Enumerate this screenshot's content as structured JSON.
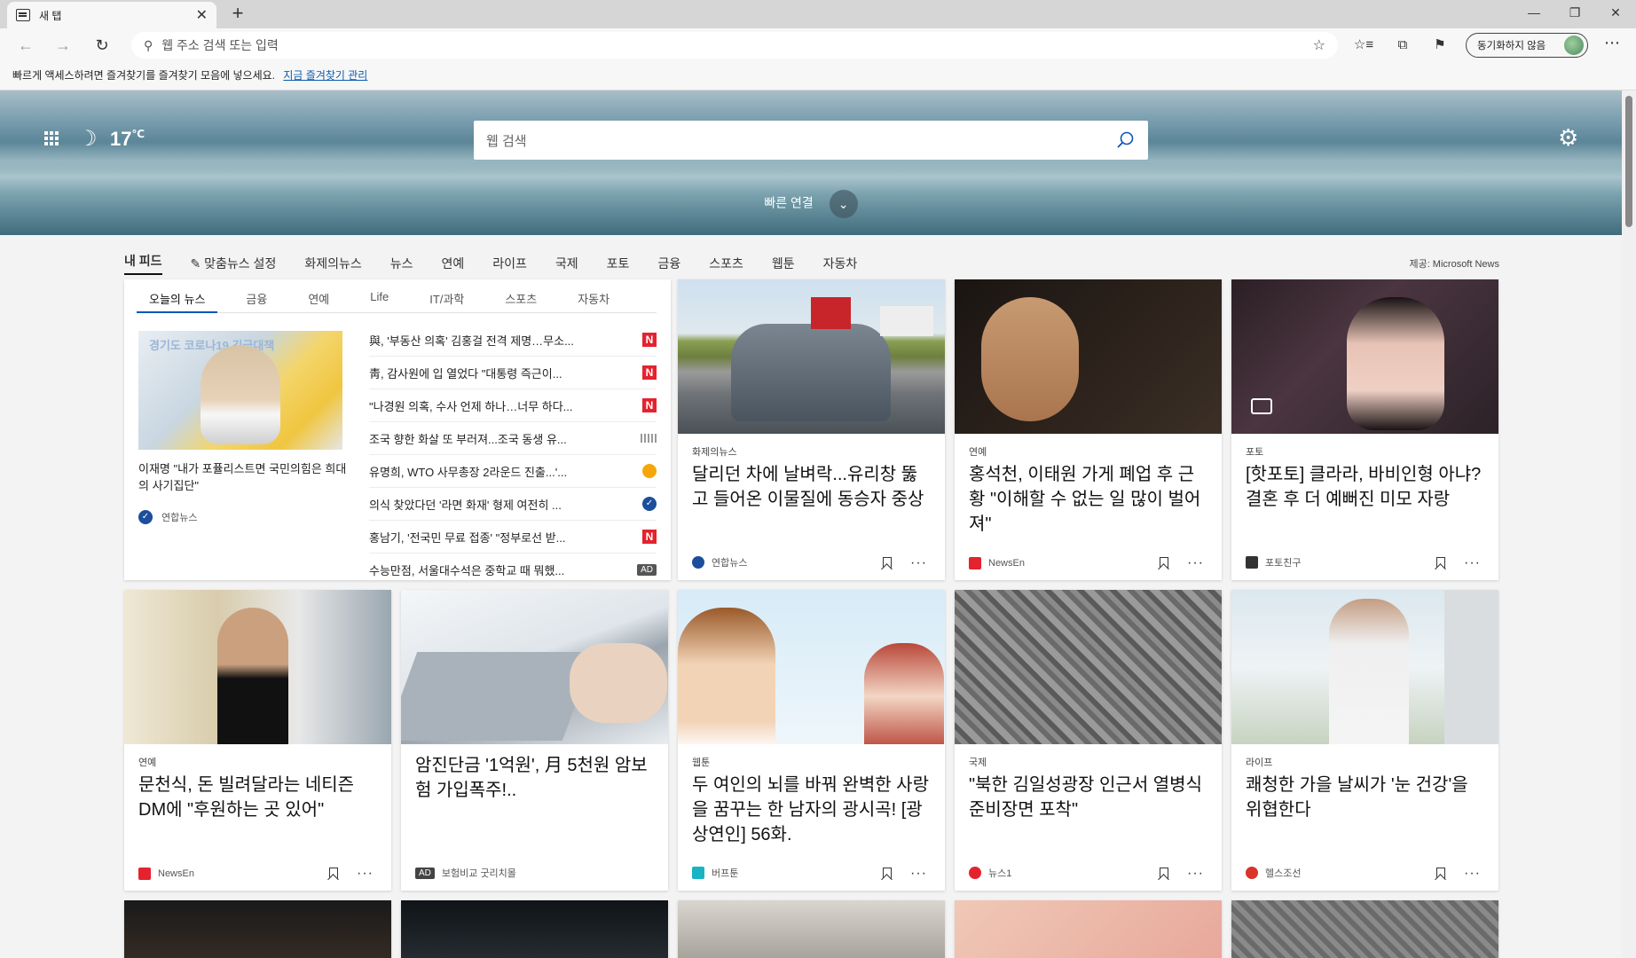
{
  "browser": {
    "tab_title": "새 탭",
    "new_tab_glyph": "+",
    "address_placeholder": "웹 주소 검색 또는 입력",
    "profile_label": "동기화하지 않음",
    "favorites_bar_text": "빠르게 액세스하려면 즐겨찾기를 즐겨찾기 모음에 넣으세요.",
    "favorites_bar_link": "지금 즐겨찾기 관리"
  },
  "hero": {
    "temperature": "17",
    "temp_unit": "℃",
    "search_placeholder": "웹 검색",
    "quick_links_label": "빠른 연결"
  },
  "feed_nav": {
    "items": [
      "내 피드",
      "✎ 맞춤뉴스 설정",
      "화제의뉴스",
      "뉴스",
      "연예",
      "라이프",
      "국제",
      "포토",
      "금융",
      "스포츠",
      "웹툰",
      "자동차"
    ],
    "provider": "제공: Microsoft News"
  },
  "today": {
    "tabs": [
      "오늘의 뉴스",
      "금융",
      "연예",
      "Life",
      "IT/과학",
      "스포츠",
      "자동차"
    ],
    "caption": "이재명 \"내가 포퓰리스트면 국민의힘은 희대의 사기집단\"",
    "source": "연합뉴스",
    "image_text": "경기도 코로나19 긴급대책",
    "headlines": [
      {
        "text": "與, '부동산 의혹' 김홍걸 전격 제명…무소...",
        "logo": "N"
      },
      {
        "text": "靑, 감사원에 입 열었다 \"대통령 즉근이...",
        "logo": "N"
      },
      {
        "text": "\"나경원 의혹, 수사 언제 하나…너무 하다...",
        "logo": "N"
      },
      {
        "text": "조국 향한 화살 또 부러져...조국 동생 유...",
        "logo": "G"
      },
      {
        "text": "유명희, WTO 사무총장 2라운드 진출...'...",
        "logo": "O"
      },
      {
        "text": "의식 찾았다던 '라면 화재' 형제 여전히 ...",
        "logo": "Y"
      },
      {
        "text": "홍남기, '전국민 무료 접종' \"정부로선 받...",
        "logo": "N"
      },
      {
        "text": "수능만점, 서울대수석은 중학교 때 뭐했...",
        "logo": "AD"
      }
    ]
  },
  "cards": [
    {
      "category": "화제의뉴스",
      "title": "달리던 차에 날벼락...유리창 뚫고 들어온 이물질에 동승자 중상",
      "source": "연합뉴스"
    },
    {
      "category": "연예",
      "title": "홍석천, 이태원 가게 폐업 후 근황 \"이해할 수 없는 일 많이 벌어져\"",
      "source": "NewsEn"
    },
    {
      "category": "포토",
      "title": "[핫포토] 클라라, 바비인형 아냐? 결혼 후 더 예뻐진 미모 자랑",
      "source": "포토친구"
    },
    {
      "category": "연예",
      "title": "문천식, 돈 빌려달라는 네티즌 DM에 \"후원하는 곳 있어\"",
      "source": "NewsEn"
    },
    {
      "category": "",
      "title": "암진단금 '1억원', 月 5천원 암보험 가입폭주!..",
      "source": "보험비교 굿리치몰",
      "ad": "AD"
    },
    {
      "category": "웹툰",
      "title": "두 여인의 뇌를 바꿔 완벽한 사랑을 꿈꾸는 한 남자의 광시곡! [광상연인] 56화.",
      "source": "버프툰"
    },
    {
      "category": "국제",
      "title": "\"북한 김일성광장 인근서 열병식 준비장면 포착\"",
      "source": "뉴스1"
    },
    {
      "category": "라이프",
      "title": "쾌청한 가을 날씨가 '눈 건강'을 위협한다",
      "source": "헬스조선"
    }
  ],
  "colors": {
    "accent": "#0a56b8",
    "newsen_red": "#e4232e"
  }
}
